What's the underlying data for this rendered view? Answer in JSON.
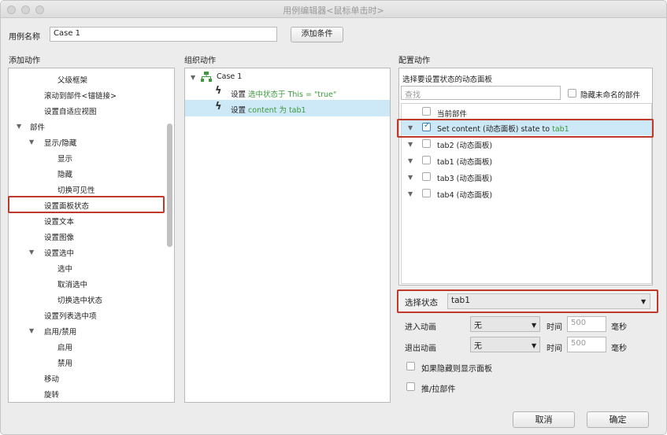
{
  "window": {
    "title": "用例编辑器<鼠标单击时>"
  },
  "top": {
    "case_name_label": "用例名称",
    "case_name_value": "Case 1",
    "add_condition_label": "添加条件"
  },
  "left": {
    "header": "添加动作",
    "items": [
      {
        "label": "父级框架"
      },
      {
        "label": "滚动到部件<锚链接>"
      },
      {
        "label": "设置自适应视图"
      },
      {
        "label": "部件"
      },
      {
        "label": "显示/隐藏"
      },
      {
        "label": "显示"
      },
      {
        "label": "隐藏"
      },
      {
        "label": "切换可见性"
      },
      {
        "label": "设置面板状态"
      },
      {
        "label": "设置文本"
      },
      {
        "label": "设置图像"
      },
      {
        "label": "设置选中"
      },
      {
        "label": "选中"
      },
      {
        "label": "取消选中"
      },
      {
        "label": "切换选中状态"
      },
      {
        "label": "设置列表选中项"
      },
      {
        "label": "启用/禁用"
      },
      {
        "label": "启用"
      },
      {
        "label": "禁用"
      },
      {
        "label": "移动"
      },
      {
        "label": "旋转"
      }
    ]
  },
  "middle": {
    "header": "组织动作",
    "case_label": "Case 1",
    "actions": [
      {
        "prefix": "设置",
        "target": "选中状态于 This = \"true\""
      },
      {
        "prefix": "设置",
        "target": "content 为 tab1"
      }
    ]
  },
  "right": {
    "header": "配置动作",
    "subheader": "选择要设置状态的动态面板",
    "search_placeholder": "查找",
    "hide_unnamed_label": "隐藏未命名的部件",
    "current_widget_label": "当前部件",
    "selected_item": {
      "prefix": "Set content (动态面板) state to",
      "value": "tab1"
    },
    "items": [
      {
        "label": "tab2 (动态面板)"
      },
      {
        "label": "tab1 (动态面板)"
      },
      {
        "label": "tab3 (动态面板)"
      },
      {
        "label": "tab4 (动态面板)"
      }
    ],
    "select_state_label": "选择状态",
    "select_state_value": "tab1",
    "enter_anim_label": "进入动画",
    "enter_anim_value": "无",
    "exit_anim_label": "退出动画",
    "exit_anim_value": "无",
    "time_label": "时间",
    "time_value_enter": "500",
    "time_value_exit": "500",
    "ms_label": "毫秒",
    "show_if_hidden_label": "如果隐藏则显示面板",
    "push_pull_label": "推/拉部件"
  },
  "footer": {
    "cancel_label": "取消",
    "ok_label": "确定"
  },
  "colors": {
    "highlight_red": "#c0392b",
    "selection_blue": "#cde8f6",
    "accent_green": "#3c9a3c"
  }
}
